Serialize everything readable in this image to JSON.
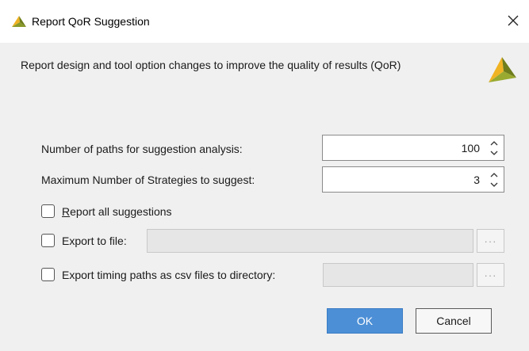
{
  "window": {
    "title": "Report QoR Suggestion",
    "logo_icon": "vivado-logo-icon",
    "close_icon": "close-icon"
  },
  "banner": {
    "description": "Report design and tool option changes to improve the quality of results (QoR)",
    "logo_icon": "vivado-logo-icon"
  },
  "form": {
    "num_paths": {
      "label": "Number of paths for suggestion analysis:",
      "value": "100"
    },
    "max_strategies": {
      "label": "Maximum Number of Strategies to suggest:",
      "value": "3"
    },
    "report_all": {
      "label_mnemonic": "R",
      "label_rest": "eport all suggestions",
      "checked": false
    },
    "export_file": {
      "label": "Export to file:",
      "value": "",
      "checked": false
    },
    "export_csv": {
      "label": "Export timing paths as csv files to directory:",
      "value": "",
      "checked": false
    },
    "browse_label": "···"
  },
  "buttons": {
    "ok_label": "OK",
    "cancel_label": "Cancel"
  },
  "colors": {
    "accent": "#4c8fd6",
    "logo_yellow": "#f0b323",
    "logo_green": "#6f7d1c"
  }
}
